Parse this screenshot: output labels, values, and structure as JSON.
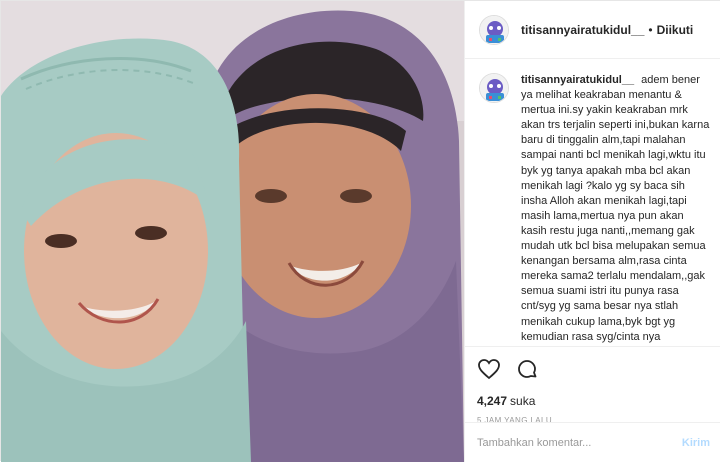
{
  "header": {
    "username": "titisannyairatukidul__",
    "separator": "•",
    "follow_status": "Diikuti"
  },
  "caption": {
    "username": "titisannyairatukidul__",
    "text": "adem bener ya melihat keakraban menantu & mertua ini.sy yakin keakraban mrk akan trs terjalin seperti ini,bukan karna baru di tinggalin alm,tapi malahan sampai nanti bcl menikah lagi,wktu itu byk yg tanya apakah mba bcl akan menikah lagi ?kalo yg sy baca sih insha Alloh akan menikah lagi,tapi masih lama,mertua nya pun akan kasih restu juga nanti,,memang gak mudah utk bcl bisa melupakan semua kenangan bersama alm,rasa cinta mereka sama2 terlalu mendalam,,gak semua suami istri itu punya rasa cnt/syg yg sama besar nya stlah menikah cukup lama,byk bgt yg kemudian rasa syg/cinta nya berkurang dan bahkan berganti dengan rasa jenuh,bosen,ilfeel & bahkan sampai ada yg selingkuh..."
  },
  "actions": {
    "like_icon": "heart-icon",
    "comment_icon": "comment-bubble-icon",
    "likes_count": "4,247",
    "likes_suffix": "suka",
    "timestamp": "5 JAM YANG LALU"
  },
  "comment_box": {
    "placeholder": "Tambahkan komentar...",
    "send_label": "Kirim"
  },
  "colors": {
    "border": "#efefef",
    "text": "#262626",
    "muted": "#999999",
    "send_disabled": "#b3dbff",
    "hijab_left": "#a7cbc4",
    "hijab_right": "#8a759c"
  }
}
